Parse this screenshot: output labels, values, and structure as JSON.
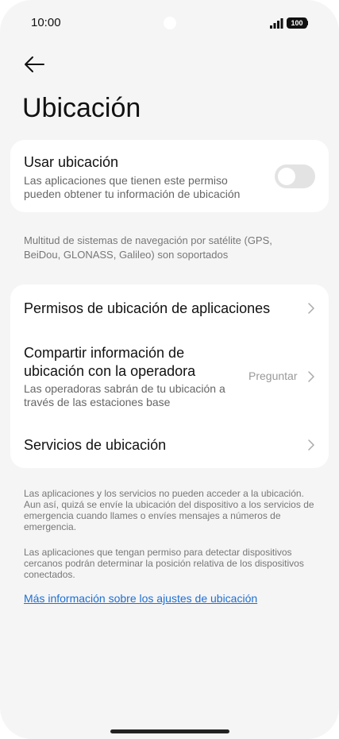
{
  "status_bar": {
    "time": "10:00",
    "battery": "100"
  },
  "page": {
    "title": "Ubicación"
  },
  "use_location": {
    "title": "Usar ubicación",
    "subtitle_line1": "Las aplicaciones que tienen este permiso",
    "subtitle_line2": "pueden obtener tu información de ubicación",
    "toggle_on": false
  },
  "gnss_note": {
    "line1": "Multitud de sistemas de navegación por satélite (GPS,",
    "line2": "BeiDou, GLONASS, Galileo) son soportados"
  },
  "settings_list": {
    "app_permissions": {
      "label": "Permisos de ubicación de aplicaciones"
    },
    "carrier_sharing": {
      "label_line1": "Compartir información de",
      "label_line2": "ubicación con la operadora",
      "sub_line1": "Las operadoras sabrán de tu ubicación a",
      "sub_line2": "través de las estaciones base",
      "value": "Preguntar"
    },
    "location_services": {
      "label": "Servicios de ubicación"
    }
  },
  "footer": {
    "emergency_note": "Las aplicaciones y los servicios no pueden acceder a la ubicación. Aun así, quizá se envíe la ubicación del dispositivo a los servicios de emergencia cuando llames o envíes mensajes a números de emergencia.",
    "nearby_note": "Las aplicaciones que tengan permiso para detectar dispositivos cercanos podrán determinar la posición relativa de los dispositivos conectados.",
    "learn_more_link": "Más información sobre los ajustes de ubicación"
  },
  "colors": {
    "background": "#f5f5f5",
    "card": "#ffffff",
    "link": "#1d6fd6",
    "toggle_off": "#e3e3e3"
  },
  "icons": {
    "back": "back-arrow-icon",
    "chevron": "chevron-right-icon",
    "signal": "signal-icon",
    "battery": "battery-icon"
  }
}
